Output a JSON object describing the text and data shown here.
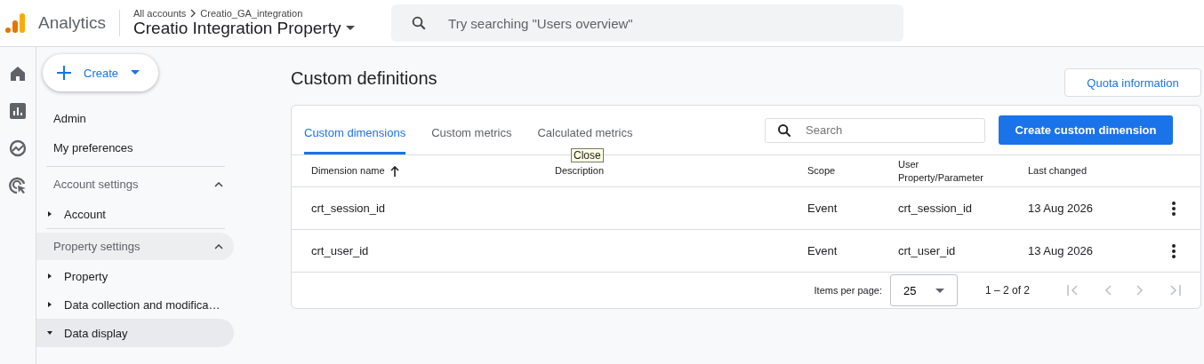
{
  "header": {
    "product": "Analytics",
    "breadcrumb": [
      "All accounts",
      "Creatio_GA_integration"
    ],
    "property": "Creatio Integration Property",
    "search": {
      "placeholder": "Try searching \"Users overview\""
    }
  },
  "rail": [
    {
      "kind": "home",
      "selected": false
    },
    {
      "kind": "reports",
      "selected": false
    },
    {
      "kind": "explore",
      "selected": false
    },
    {
      "kind": "advertising",
      "selected": false
    }
  ],
  "create_button": "Create",
  "sidebar": {
    "items": [
      {
        "label": "Admin"
      },
      {
        "label": "My preferences"
      }
    ],
    "sections": [
      {
        "title": "Account settings",
        "expanded": true,
        "selected": false,
        "items": [
          {
            "label": "Account",
            "expanded": false,
            "selected": false
          }
        ]
      },
      {
        "title": "Property settings",
        "expanded": true,
        "selected": true,
        "items": [
          {
            "label": "Property",
            "expanded": false,
            "selected": false
          },
          {
            "label": "Data collection and modifica…",
            "expanded": false,
            "selected": false
          },
          {
            "label": "Data display",
            "expanded": true,
            "selected": true
          }
        ]
      }
    ]
  },
  "page_title": "Custom definitions",
  "quota_button": "Quota information",
  "tabs": [
    {
      "label": "Custom dimensions",
      "selected": true
    },
    {
      "label": "Custom metrics",
      "selected": false
    },
    {
      "label": "Calculated metrics",
      "selected": false
    }
  ],
  "search": {
    "placeholder": "Search"
  },
  "create_custom_button": "Create custom dimension",
  "tooltip": "Close",
  "table": {
    "columns": [
      {
        "label": "Dimension name",
        "sorted": true
      },
      {
        "label": "Description",
        "sorted": false
      },
      {
        "label": "Scope",
        "sorted": false
      },
      {
        "label": "User Property/Parameter",
        "sorted": false
      },
      {
        "label": "Last changed",
        "sorted": false
      }
    ],
    "rows": [
      [
        "crt_session_id",
        "",
        "Event",
        "crt_session_id",
        "13 Aug 2026"
      ],
      [
        "crt_user_id",
        "",
        "Event",
        "crt_user_id",
        "13 Aug 2026"
      ]
    ]
  },
  "pagination": {
    "label": "Items per page:",
    "page_size": "25",
    "range": "1 – 2 of 2"
  }
}
